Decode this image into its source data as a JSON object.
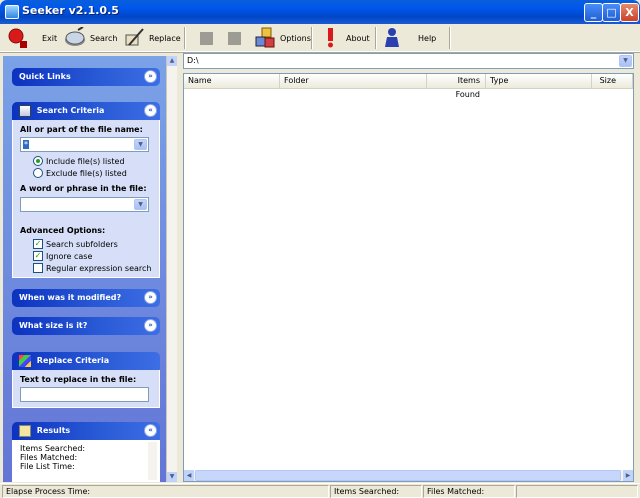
{
  "window": {
    "title": "Seeker v2.1.0.5",
    "minimize_label": "_",
    "maximize_label": "□",
    "close_label": "X"
  },
  "toolbar": {
    "exit_label": "Exit",
    "search_label": "Search",
    "replace_label": "Replace",
    "options_label": "Options",
    "about_label": "About",
    "help_label": "Help"
  },
  "sidebar": {
    "quick_links": {
      "title": "Quick Links"
    },
    "search_criteria": {
      "title": "Search Criteria",
      "filename_label": "All or part of the file name:",
      "filename_value": "*",
      "include_label": "Include file(s) listed",
      "exclude_label": "Exclude file(s) listed",
      "phrase_label": "A word or phrase in the file:",
      "phrase_value": "",
      "advanced_label": "Advanced Options:",
      "subfolders_label": "Search subfolders",
      "ignore_case_label": "Ignore case",
      "regex_label": "Regular expression search",
      "include_selected": true,
      "subfolders_checked": true,
      "ignore_case_checked": true,
      "regex_checked": false
    },
    "modified": {
      "title": "When was it modified?"
    },
    "size": {
      "title": "What size is it?"
    },
    "replace_criteria": {
      "title": "Replace Criteria",
      "text_label": "Text to replace in the file:",
      "text_value": ""
    },
    "results": {
      "title": "Results",
      "items_searched": "Items Searched:",
      "files_matched": "Files Matched:",
      "file_list_time": "File List Time:"
    }
  },
  "path": {
    "value": "D:\\"
  },
  "list": {
    "columns": [
      "Name",
      "Folder",
      "Items Found",
      "Type",
      "Size"
    ]
  },
  "status": {
    "elapse": "Elapse Process Time:",
    "items_searched": "Items Searched:",
    "files_matched": "Files Matched:"
  },
  "colors": {
    "title_blue": "#0054e3",
    "panel_header": "#2a5bd6",
    "sidebar_bg": "#6f8ce0"
  }
}
